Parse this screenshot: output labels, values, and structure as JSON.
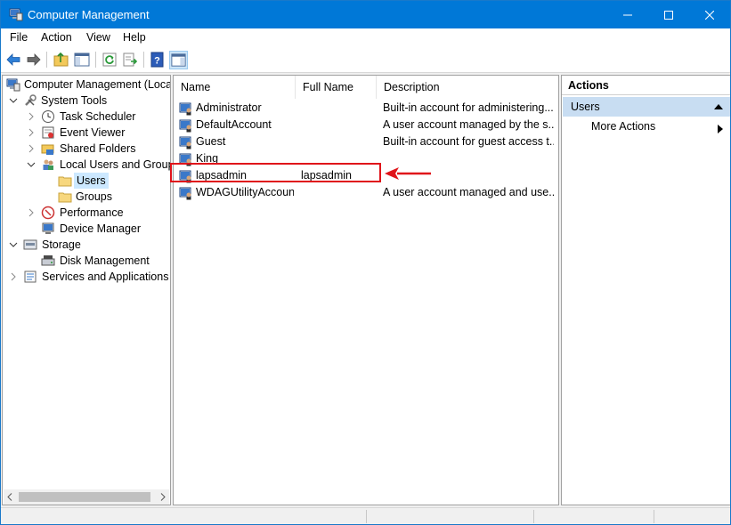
{
  "window": {
    "title": "Computer Management"
  },
  "menu": [
    "File",
    "Action",
    "View",
    "Help"
  ],
  "tree": [
    {
      "label": "Computer Management (Local",
      "icon": "computer-management-icon"
    },
    {
      "label": "System Tools",
      "icon": "tools-icon"
    },
    {
      "label": "Task Scheduler",
      "icon": "clock-icon"
    },
    {
      "label": "Event Viewer",
      "icon": "event-viewer-icon"
    },
    {
      "label": "Shared Folders",
      "icon": "shared-folder-icon"
    },
    {
      "label": "Local Users and Groups",
      "icon": "users-groups-icon"
    },
    {
      "label": "Users",
      "icon": "folder-icon"
    },
    {
      "label": "Groups",
      "icon": "folder-icon"
    },
    {
      "label": "Performance",
      "icon": "performance-icon"
    },
    {
      "label": "Device Manager",
      "icon": "device-manager-icon"
    },
    {
      "label": "Storage",
      "icon": "storage-icon"
    },
    {
      "label": "Disk Management",
      "icon": "disk-icon"
    },
    {
      "label": "Services and Applications",
      "icon": "services-icon"
    }
  ],
  "columns": {
    "name": "Name",
    "full_name": "Full Name",
    "description": "Description"
  },
  "users": [
    {
      "name": "Administrator",
      "full_name": "",
      "description": "Built-in account for administering..."
    },
    {
      "name": "DefaultAccount",
      "full_name": "",
      "description": "A user account managed by the s..."
    },
    {
      "name": "Guest",
      "full_name": "",
      "description": "Built-in account for guest access t..."
    },
    {
      "name": "King",
      "full_name": "",
      "description": ""
    },
    {
      "name": "lapsadmin",
      "full_name": "lapsadmin",
      "description": ""
    },
    {
      "name": "WDAGUtilityAccount",
      "full_name": "",
      "description": "A user account managed and use..."
    }
  ],
  "actions": {
    "title": "Actions",
    "section": "Users",
    "item": "More Actions"
  },
  "colors": {
    "titlebar": "#0078d7",
    "selection": "#cce8ff",
    "actions_section": "#c8ddf2",
    "annotation": "#e0141a"
  }
}
